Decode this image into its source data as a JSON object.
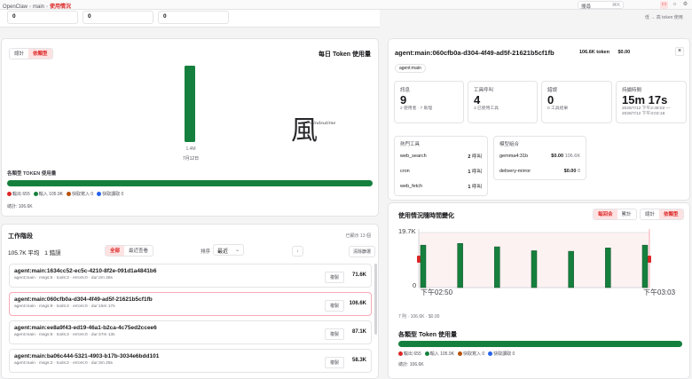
{
  "topbar": {
    "breadcrumb": [
      "OpenClaw",
      "main",
      "使用情況"
    ],
    "search_placeholder": "搜尋",
    "search_shortcut": "⌘K",
    "icons": [
      "monitor-icon",
      "sun-icon",
      "gear-icon"
    ]
  },
  "top_stats": [
    "0",
    "0",
    "0"
  ],
  "left_note": "低 → 高 token 使用",
  "daily": {
    "tabs": [
      "總計",
      "依類型"
    ],
    "active_tab": "依類型",
    "title": "每日 Token 使用量",
    "bar_value_label": "1.4M",
    "bar_date": "7月12日",
    "watermark": "風",
    "watermark_sub": "windsutime",
    "chart_data": {
      "type": "bar",
      "categories": [
        "7月12日"
      ],
      "values": [
        1.4
      ],
      "title": "每日 Token 使用量",
      "ylabel": ""
    }
  },
  "by_type": {
    "title": "各類型 TOKEN 使用量",
    "legend": [
      {
        "label": "輸出 655",
        "color": "#dc2626"
      },
      {
        "label": "輸入 105.9K",
        "color": "#15803d"
      },
      {
        "label": "快取寫入 0",
        "color": "#b45309"
      },
      {
        "label": "快取讀取 0",
        "color": "#2563eb"
      }
    ],
    "total": "總計: 106.6K"
  },
  "sessions": {
    "title": "工作階段",
    "selected_info": "已顯示 13 個",
    "summary_avg": "105.7K 平均",
    "summary_count": "1 錯誤",
    "filters": [
      "全部",
      "最近查看"
    ],
    "active_filter": "全部",
    "sort_label": "排序",
    "sort_value": "最近",
    "sort_dir": "↓",
    "clear_button": "清除篩選",
    "copy_label": "複製",
    "items": [
      {
        "id": "agent:main:1634cc52-ec5c-4210-8f2e-091d1a4841b6",
        "meta": "agent:main · msgs:5 · tools:3 · errors:0 · dur:2m 36s",
        "tokens": "71.6K"
      },
      {
        "id": "agent:main:060cfb0a-d304-4f49-ad5f-21621b5cf1fb",
        "meta": "agent:main · msgs:9 · tools:4 · errors:0 · dur:15m 17s",
        "tokens": "106.6K"
      },
      {
        "id": "agent:main:ee8a9f43-ed19-46a1-b2ca-4c75ed2ccee6",
        "meta": "agent:main · msgs:6 · tools:3 · errors:0 · dur:47m 13s",
        "tokens": "87.1K"
      },
      {
        "id": "agent:main:ba06c444-5321-4903-b17b-3034e6bdd101",
        "meta": "agent:main · msgs:2 · tools:2 · errors:0 · dur:3m 25s",
        "tokens": "58.3K"
      }
    ]
  },
  "detail": {
    "title": "agent:main:060cfb0a-d304-4f49-ad5f-21621b5cf1fb",
    "tokens": "106.6K token",
    "cost": "$0.00",
    "close": "×",
    "tag": "agent:main",
    "metrics": [
      {
        "label": "訊息",
        "value": "9",
        "sub": "2 使用者 · 7 助理"
      },
      {
        "label": "工具呼叫",
        "value": "4",
        "sub": "3 已使用工具"
      },
      {
        "label": "錯誤",
        "value": "0",
        "sub": "0 工具結果"
      },
      {
        "label": "持續時間",
        "value": "15m 17s",
        "sub": "2026/7/12 下午2:48:02 — 2026/7/12 下午3:03:18"
      }
    ],
    "top_tools_title": "熱門工具",
    "top_tools": [
      {
        "name": "web_search",
        "count": "2",
        "unit": "呼叫"
      },
      {
        "name": "cron",
        "count": "1",
        "unit": "呼叫"
      },
      {
        "name": "web_fetch",
        "count": "1",
        "unit": "呼叫"
      }
    ],
    "model_mix_title": "模型組合",
    "models": [
      {
        "name": "gemma4:31b",
        "cost": "$0.00",
        "tokens": "106.6K"
      },
      {
        "name": "delivery-mirror",
        "cost": "$0.00",
        "tokens": "0"
      }
    ]
  },
  "timeline": {
    "title": "使用情況隨時間變化",
    "toggle_a": [
      "每回合",
      "累計"
    ],
    "toggle_a_active": "每回合",
    "toggle_b": [
      "總計",
      "依類型"
    ],
    "toggle_b_active": "依類型",
    "y_max_label": "19.7K",
    "y_min_label": "0",
    "x_start": "下午02:50",
    "x_end": "下午03:03",
    "footer": "7 則 · 106.6K · $0.00",
    "chart_data": {
      "type": "bar",
      "values": [
        15.2,
        15.8,
        14.6,
        13.2,
        13.0,
        14.2,
        15.2
      ],
      "ylim": [
        0,
        19.7
      ],
      "xlabel": "",
      "ylabel": ""
    }
  },
  "detail_by_type": {
    "title": "各類型 Token 使用量",
    "total": "總計: 106.6K"
  }
}
